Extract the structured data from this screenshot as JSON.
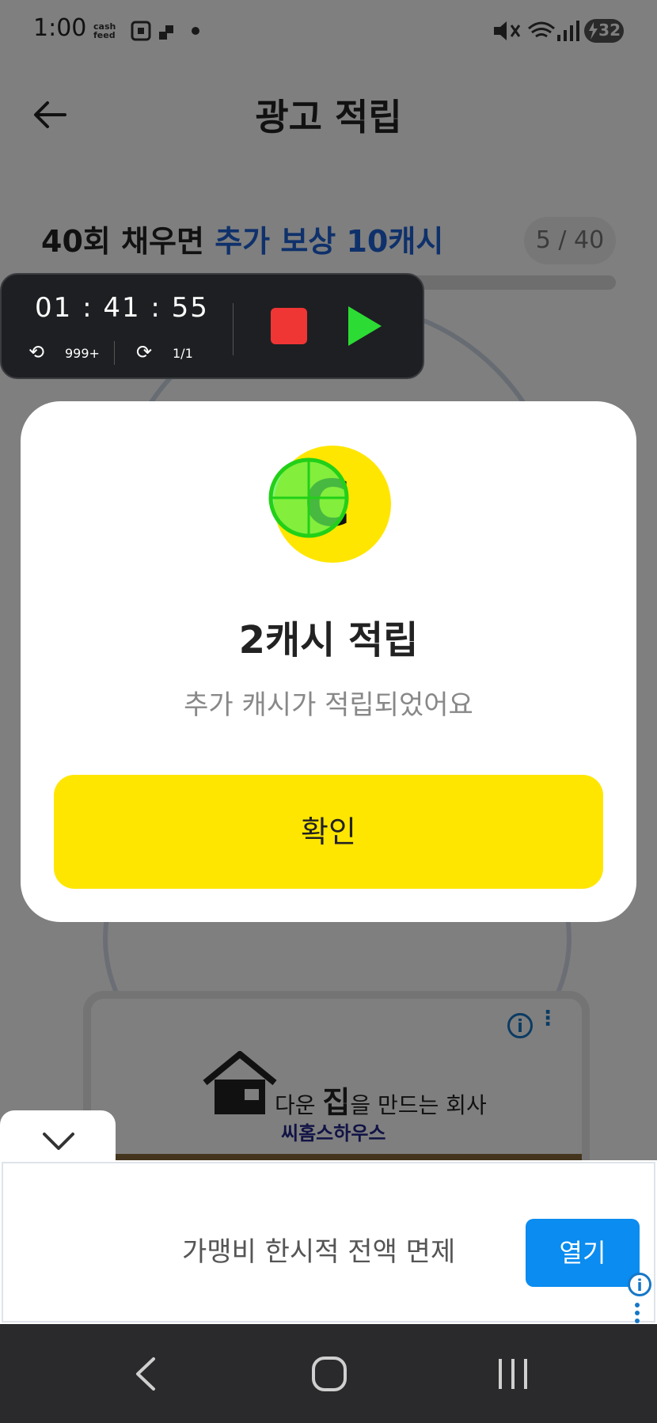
{
  "status_bar": {
    "time": "1:00",
    "app_tag_top": "cash",
    "app_tag_bottom": "feed",
    "battery": "32"
  },
  "header": {
    "title": "광고 적립"
  },
  "goal": {
    "prefix": "40회 채우면 ",
    "highlight": "추가 보상 10캐시",
    "counter": "5 / 40",
    "progress_fraction": 0.125
  },
  "recorder": {
    "timer": "01 : 41 : 55",
    "loop_count": "999+",
    "repeat_count": "1/1"
  },
  "modal": {
    "title": "2캐시 적립",
    "subtitle": "추가 캐시가 적립되었어요",
    "confirm_label": "확인",
    "coin_letter": "C"
  },
  "ad_card": {
    "house_text_pre": "다운 ",
    "house_text_em": "집",
    "house_text_post": "을 만드는 회사",
    "brand": "씨홈스하우스"
  },
  "bottom_ad": {
    "copy": "가맹비 한시적 전액 면제",
    "open_label": "열기"
  },
  "colors": {
    "accent_yellow": "#ffe600",
    "highlight_blue": "#1e63d6",
    "open_button_blue": "#0a8cf0",
    "stop_red": "#f03535",
    "play_green": "#2cdc34"
  }
}
